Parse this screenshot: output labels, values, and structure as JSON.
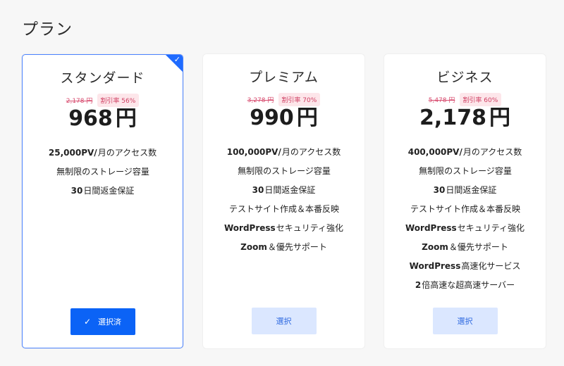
{
  "page": {
    "title": "プラン"
  },
  "plans": [
    {
      "name": "スタンダード",
      "old_price": "2,178 円",
      "discount": "割引率 56%",
      "price_value": "968",
      "price_unit": "円",
      "features": [
        {
          "strong": "25,000PV/",
          "rest": "月のアクセス数"
        },
        {
          "strong": "",
          "rest": "無制限のストレージ容量"
        },
        {
          "strong": "30",
          "rest": "日間返金保証"
        }
      ],
      "button_label": "選択済",
      "selected": true
    },
    {
      "name": "プレミアム",
      "old_price": "3,278 円",
      "discount": "割引率 70%",
      "price_value": "990",
      "price_unit": "円",
      "features": [
        {
          "strong": "100,000PV/",
          "rest": "月のアクセス数"
        },
        {
          "strong": "",
          "rest": "無制限のストレージ容量"
        },
        {
          "strong": "30",
          "rest": "日間返金保証"
        },
        {
          "strong": "",
          "rest": "テストサイト作成＆本番反映"
        },
        {
          "strong": "WordPress",
          "rest": "セキュリティ強化"
        },
        {
          "strong": "Zoom",
          "rest": "＆優先サポート"
        }
      ],
      "button_label": "選択",
      "selected": false
    },
    {
      "name": "ビジネス",
      "old_price": "5,478 円",
      "discount": "割引率 60%",
      "price_value": "2,178",
      "price_unit": "円",
      "features": [
        {
          "strong": "400,000PV/",
          "rest": "月のアクセス数"
        },
        {
          "strong": "",
          "rest": "無制限のストレージ容量"
        },
        {
          "strong": "30",
          "rest": "日間返金保証"
        },
        {
          "strong": "",
          "rest": "テストサイト作成＆本番反映"
        },
        {
          "strong": "WordPress",
          "rest": "セキュリティ強化"
        },
        {
          "strong": "Zoom",
          "rest": "＆優先サポート"
        },
        {
          "strong": "WordPress",
          "rest": "高速化サービス"
        },
        {
          "strong": "2",
          "rest": "倍高速な超高速サーバー"
        }
      ],
      "button_label": "選択",
      "selected": false
    }
  ],
  "colors": {
    "accent": "#0b63f6",
    "selected_border": "#4b83ff",
    "discount_text": "#cf3e62",
    "discount_bg": "#fde6ea",
    "secondary_button_bg": "#dbe7ff"
  },
  "icons": {
    "selected_corner": "check-icon",
    "button_check": "check-icon"
  }
}
